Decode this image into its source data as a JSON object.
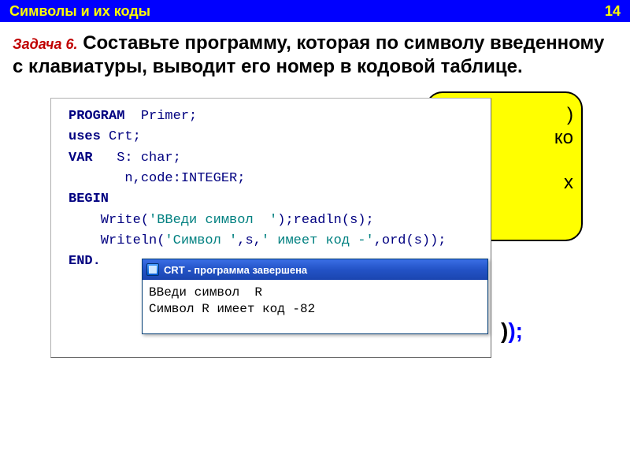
{
  "header": {
    "title": "Символы  и их коды",
    "page_num": "14"
  },
  "task": {
    "label": "Задача 6.",
    "text": " Составьте программу, которая по символу введенному с клавиатуры, выводит его номер в кодовой таблице."
  },
  "yellow_box": {
    "line1": ")",
    "line2": "ко",
    "line3": "х"
  },
  "code": {
    "kw_program": "PROGRAM",
    "program_name": "  Primer;",
    "kw_uses": "uses",
    "uses_val": " Crt;",
    "kw_var": "VAR",
    "var_s": "   S: char;",
    "var_n": "       n,code:INTEGER;",
    "kw_begin": "BEGIN",
    "write_kw": "    Write(",
    "write_str": "'ВВеди символ  '",
    "write_tail": ");readln(s);",
    "writeln_kw": "    Writeln(",
    "writeln_s1": "'Символ '",
    "writeln_m1": ",s,",
    "writeln_s2": "' имеет код -'",
    "writeln_tail": ",ord(s));",
    "kw_end": "END."
  },
  "crt": {
    "title": "CRT - программа завершена",
    "line1": "ВВеди символ  R",
    "line2": "Символ R имеет код -82"
  },
  "tail": {
    "black": ")",
    "blue": ");"
  }
}
